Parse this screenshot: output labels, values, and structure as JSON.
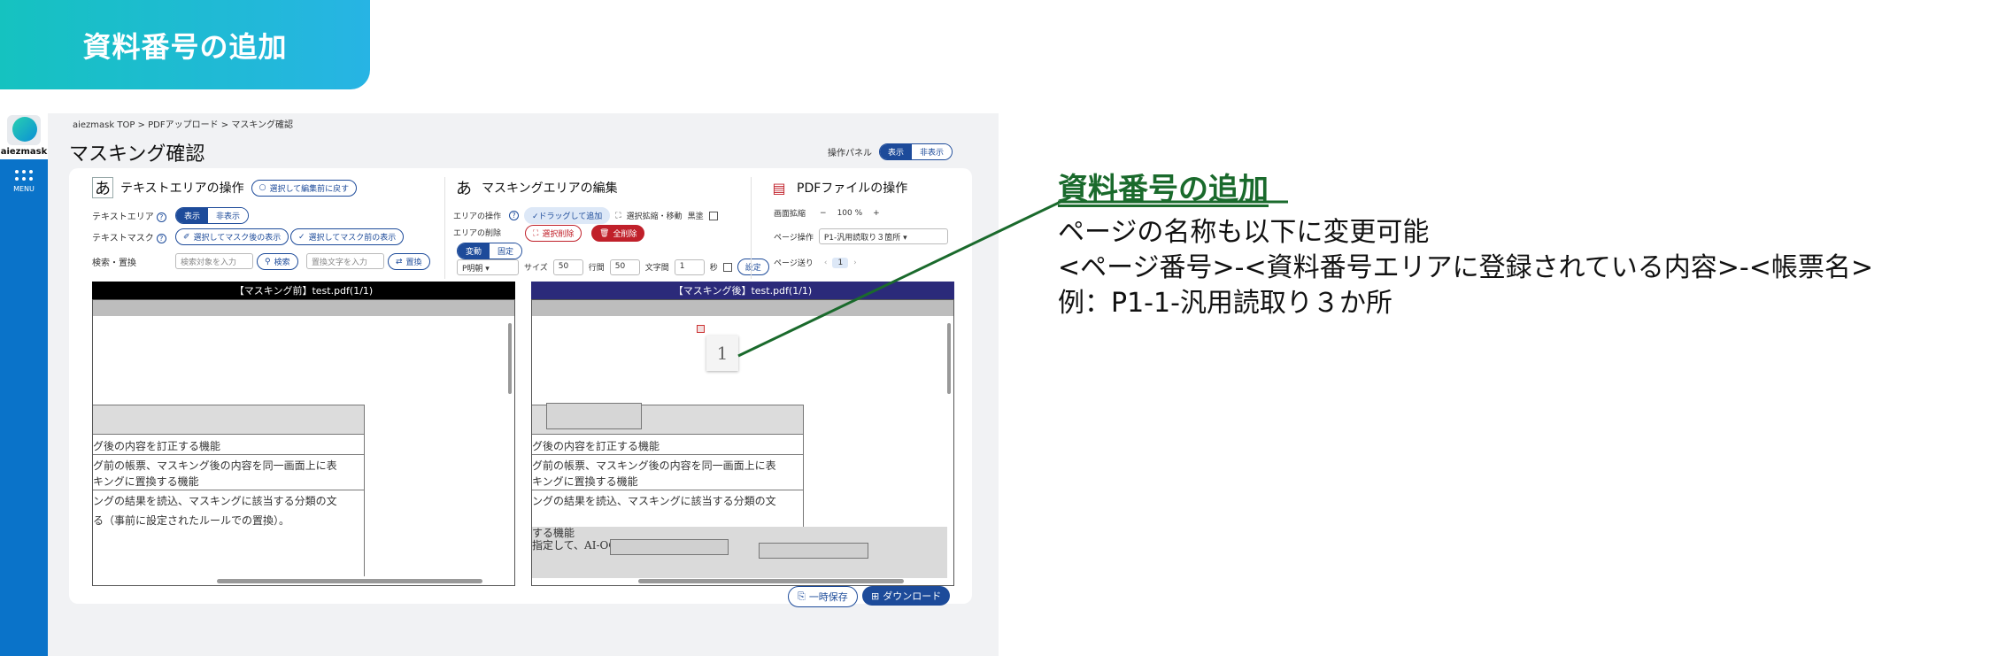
{
  "banner": {
    "title": "資料番号の追加"
  },
  "app": {
    "logo_text": "aiezmask",
    "menu_label": "MENU",
    "breadcrumb": "aiezmask TOP > PDFアップロード > マスキング確認",
    "page_title": "マスキング確認",
    "op_panel": {
      "label": "操作パネル",
      "show": "表示",
      "hide": "非表示"
    },
    "text_area": {
      "title": "テキストエリアの操作",
      "icon": "あ",
      "back_button": "選択して編集前に戻す",
      "text_area_label": "テキストエリア",
      "show": "表示",
      "hide": "非表示",
      "text_mask_label": "テキストマスク",
      "mask_after_button": "選択してマスク後の表示",
      "mask_before_button": "選択してマスク前の表示",
      "search_label": "検索・置換",
      "search_placeholder": "検索対象を入力",
      "search_button": "検索",
      "replace_placeholder": "置換文字を入力",
      "replace_button": "置換"
    },
    "mask_area": {
      "title": "マスキングエリアの編集",
      "icon": "あ",
      "area_op_label": "エリアの操作",
      "drag_add": "✓ドラッグして追加",
      "select_move": "選択拡縮・移動",
      "black_fill": "黒塗",
      "area_delete_label": "エリアの削除",
      "select_delete": "選択削除",
      "delete_all": "全削除",
      "seg_change": "変動",
      "seg_fixed": "固定",
      "font": "P明朝",
      "size_label": "サイズ",
      "size_value": "50",
      "line_label": "行間",
      "line_value": "50",
      "char_label": "文字間",
      "char_value": "1",
      "second_label": "秒",
      "set_button": "設定"
    },
    "pdf_ops": {
      "title": "PDFファイルの操作",
      "zoom_label": "画面拡縮",
      "zoom_value": "100 %",
      "page_op_label": "ページ操作",
      "page_select": "P1-汎用読取り３箇所",
      "page_nav_label": "ページ送り",
      "page_number": "1"
    },
    "before_pane": {
      "header": "【マスキング前】test.pdf(1/1)",
      "lines": [
        "グ後の内容を訂正する機能",
        "グ前の帳票、マスキング後の内容を同一画面上に表",
        "キングに置換する機能",
        "ングの結果を読込、マスキングに該当する分類の文",
        "る（事前に設定されたルールでの置換）。"
      ]
    },
    "after_pane": {
      "header": "【マスキング後】test.pdf(1/1)",
      "page_badge": "1",
      "lines": [
        "グ後の内容を訂正する機能",
        "グ前の帳票、マスキング後の内容を同一画面上に表",
        "キングに置換する機能",
        "ングの結果を読込、マスキングに該当する分類の文",
        "する機能",
        "指定して、AI-OCRのAPIを実行す"
      ]
    },
    "footer": {
      "temp_save": "一時保存",
      "download": "ダウンロード"
    }
  },
  "callout": {
    "title": "資料番号の追加",
    "lines": [
      "ページの名称も以下に変更可能",
      "<ページ番号>-<資料番号エリアに登録されている内容>-<帳票名>",
      "例：P1-1-汎用読取り３か所"
    ]
  },
  "colors": {
    "banner_from": "#15c2c0",
    "banner_to": "#27b4e4",
    "sidebar": "#0a73c9",
    "primary": "#1d4b9a",
    "callout_title": "#1a6a2c",
    "after_header": "#2b2a7a"
  }
}
